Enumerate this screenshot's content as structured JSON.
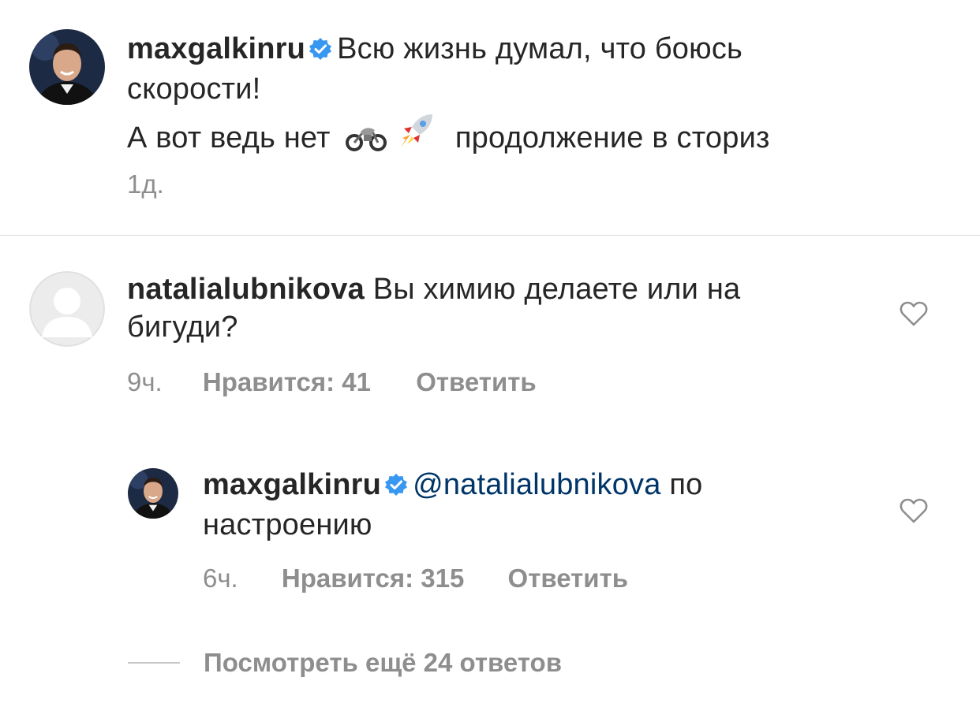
{
  "caption": {
    "username": "maxgalkinru",
    "verified": true,
    "text_line1": "Всю жизнь думал, что боюсь",
    "text_line2": "скорости!",
    "text_line3_start": "А вот ведь нет",
    "text_line3_end": "продолжение в сториз",
    "emojis": [
      "motorcycle",
      "rocket"
    ],
    "time": "1д."
  },
  "comment": {
    "username": "natalialubnikova",
    "text_line1": "Вы химию делаете или на",
    "text_line2": "бигуди?",
    "time": "9ч.",
    "likes": "Нравится: 41",
    "reply_label": "Ответить"
  },
  "reply": {
    "username": "maxgalkinru",
    "verified": true,
    "mention": "@natalialubnikova",
    "text_line1_rest": "по",
    "text_line2": "настроению",
    "time": "6ч.",
    "likes": "Нравится: 315",
    "reply_label": "Ответить"
  },
  "view_more": {
    "label": "Посмотреть ещё 24 ответов"
  },
  "colors": {
    "text": "#262626",
    "secondary": "#8e8e8e",
    "mention": "#003569",
    "verified": "#3897f0",
    "divider": "#dbdbdb"
  }
}
